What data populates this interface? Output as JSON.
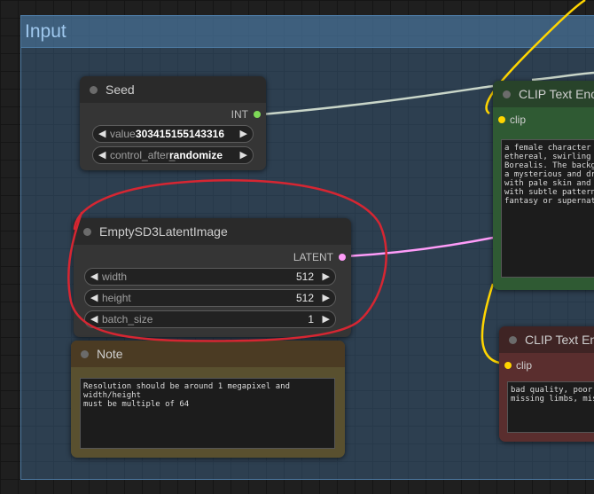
{
  "group": {
    "title": "Input"
  },
  "seed_node": {
    "title": "Seed",
    "output": "INT",
    "widgets": [
      {
        "label": "value",
        "value": "303415155143316"
      },
      {
        "label": "control_after_",
        "value": "randomize"
      }
    ]
  },
  "latent_node": {
    "title": "EmptySD3LatentImage",
    "output": "LATENT",
    "widgets": [
      {
        "label": "width",
        "value": "512"
      },
      {
        "label": "height",
        "value": "512"
      },
      {
        "label": "batch_size",
        "value": "1"
      }
    ]
  },
  "note_node": {
    "title": "Note",
    "text": "Resolution should be around 1 megapixel and width/height\nmust be multiple of 64"
  },
  "clip_positive": {
    "title": "CLIP Text Enc",
    "input": "clip",
    "text": "a female character w\nethereal, swirling p\nBorealis. The backgr\na mysterious and dra\nwith pale skin and s\nwith subtle patterns\nfantasy or supernatu"
  },
  "clip_negative": {
    "title": "CLIP Text En",
    "input": "clip",
    "text": "bad quality, poor q\nmissing limbs, miss"
  },
  "colors": {
    "int_slot": "#7ed957",
    "latent_slot": "#ff9cf9",
    "clip_wire": "#ffd500",
    "annotation": "#d62632"
  }
}
